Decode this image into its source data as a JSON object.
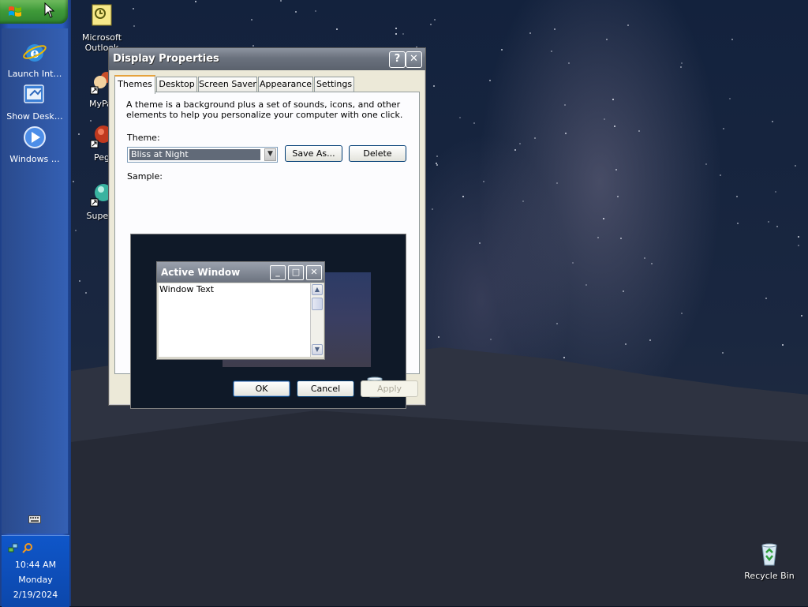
{
  "taskbar": {
    "quick_launch": [
      {
        "label": "Launch Int…",
        "icon": "internet-explorer-icon"
      },
      {
        "label": "Show Desk…",
        "icon": "show-desktop-icon"
      },
      {
        "label": "Windows …",
        "icon": "windows-media-player-icon"
      }
    ],
    "clock": {
      "time": "10:44 AM",
      "day": "Monday",
      "date": "2/19/2024"
    }
  },
  "desktop": {
    "icons": [
      {
        "label": "Microsoft Outlook",
        "icon": "outlook-icon"
      },
      {
        "label": "MyPal",
        "icon": "mypal-icon"
      },
      {
        "label": "Peg",
        "icon": "pegasus-icon"
      },
      {
        "label": "Supern",
        "icon": "supernova-icon"
      },
      {
        "label": "Recycle Bin",
        "icon": "recycle-bin-icon"
      }
    ]
  },
  "dialog": {
    "title": "Display Properties",
    "help_label": "?",
    "close_label": "✕",
    "tabs": [
      "Themes",
      "Desktop",
      "Screen Saver",
      "Appearance",
      "Settings"
    ],
    "active_tab": "Themes",
    "description": "A theme is a background plus a set of sounds, icons, and other elements to help you personalize your computer with one click.",
    "theme_label": "Theme:",
    "theme_value": "Bliss at Night",
    "save_as_label": "Save As...",
    "delete_label": "Delete",
    "sample_label": "Sample:",
    "sample": {
      "window_title": "Active Window",
      "window_text": "Window Text"
    },
    "ok_label": "OK",
    "cancel_label": "Cancel",
    "apply_label": "Apply"
  }
}
